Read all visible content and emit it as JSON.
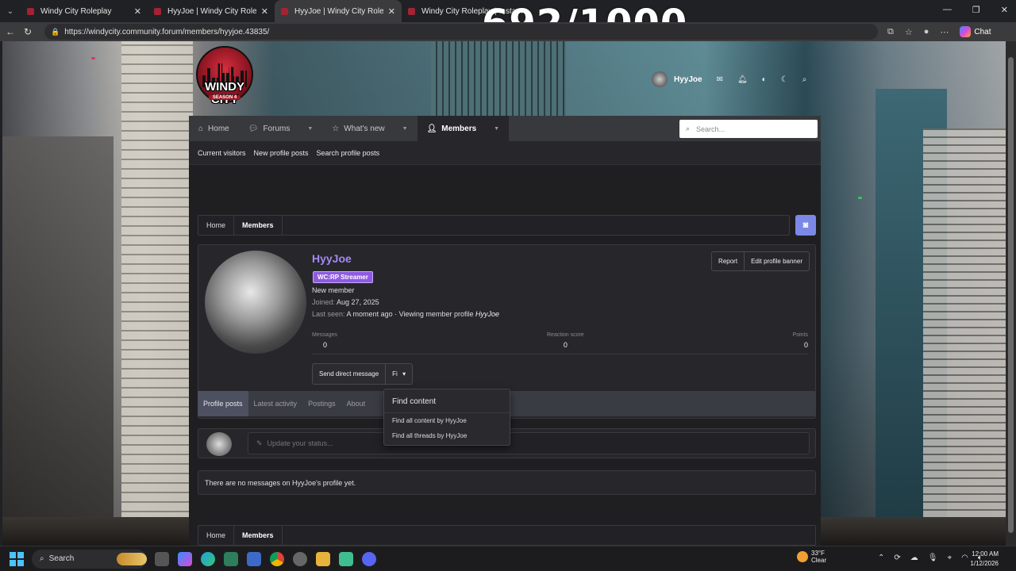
{
  "browser": {
    "tabs": [
      {
        "title": "Windy City Roleplay",
        "active": false
      },
      {
        "title": "HyyJoe | Windy City Roleplay",
        "active": false
      },
      {
        "title": "HyyJoe | Windy City Roleplay",
        "active": true
      },
      {
        "title": "Windy City Roleplay | Insta...",
        "active": false
      }
    ],
    "url": "https://windycity.community.forum/members/hyyjoe.43835/",
    "chat_label": "Chat"
  },
  "overlay": {
    "counter": "692/1000"
  },
  "site": {
    "logo_text": "WINDY CITY",
    "logo_season": "SEASON 4",
    "user": {
      "name": "HyyJoe"
    },
    "nav": [
      {
        "label": "Home",
        "icon": "home-icon"
      },
      {
        "label": "Forums",
        "icon": "forums-icon"
      },
      {
        "label": "What's new",
        "icon": "star-icon"
      },
      {
        "label": "Members",
        "icon": "members-icon"
      }
    ],
    "search_placeholder": "Search...",
    "subnav": [
      "Current visitors",
      "New profile posts",
      "Search profile posts"
    ],
    "breadcrumbs": [
      "Home",
      "Members"
    ]
  },
  "profile": {
    "name": "HyyJoe",
    "badge": "WC:RP Streamer",
    "title": "New member",
    "joined_label": "Joined:",
    "joined": "Aug 27, 2025",
    "last_seen_label": "Last seen:",
    "last_seen": "A moment ago · Viewing member profile",
    "last_seen_target": "HyyJoe",
    "buttons": {
      "report": "Report",
      "edit_banner": "Edit profile banner"
    },
    "stats": [
      {
        "label": "Messages",
        "value": "0"
      },
      {
        "label": "Reaction score",
        "value": "0"
      },
      {
        "label": "Points",
        "value": "0"
      }
    ],
    "actions": {
      "dm": "Send direct message",
      "find": "Fi"
    },
    "tabs": [
      "Profile posts",
      "Latest activity",
      "Postings",
      "About"
    ],
    "dropdown": {
      "header": "Find content",
      "items": [
        "Find all content by HyyJoe",
        "Find all threads by HyyJoe"
      ]
    },
    "status_placeholder": "Update your status...",
    "no_messages": "There are no messages on HyyJoe's profile yet."
  },
  "taskbar": {
    "search_label": "Search",
    "weather_temp": "33°F",
    "weather_desc": "Clear",
    "time": "12:00 AM",
    "date": "1/12/2026"
  },
  "colors": {
    "accent": "#a389f4",
    "badge": "#8e5be0",
    "discord": "#7b88e6"
  }
}
